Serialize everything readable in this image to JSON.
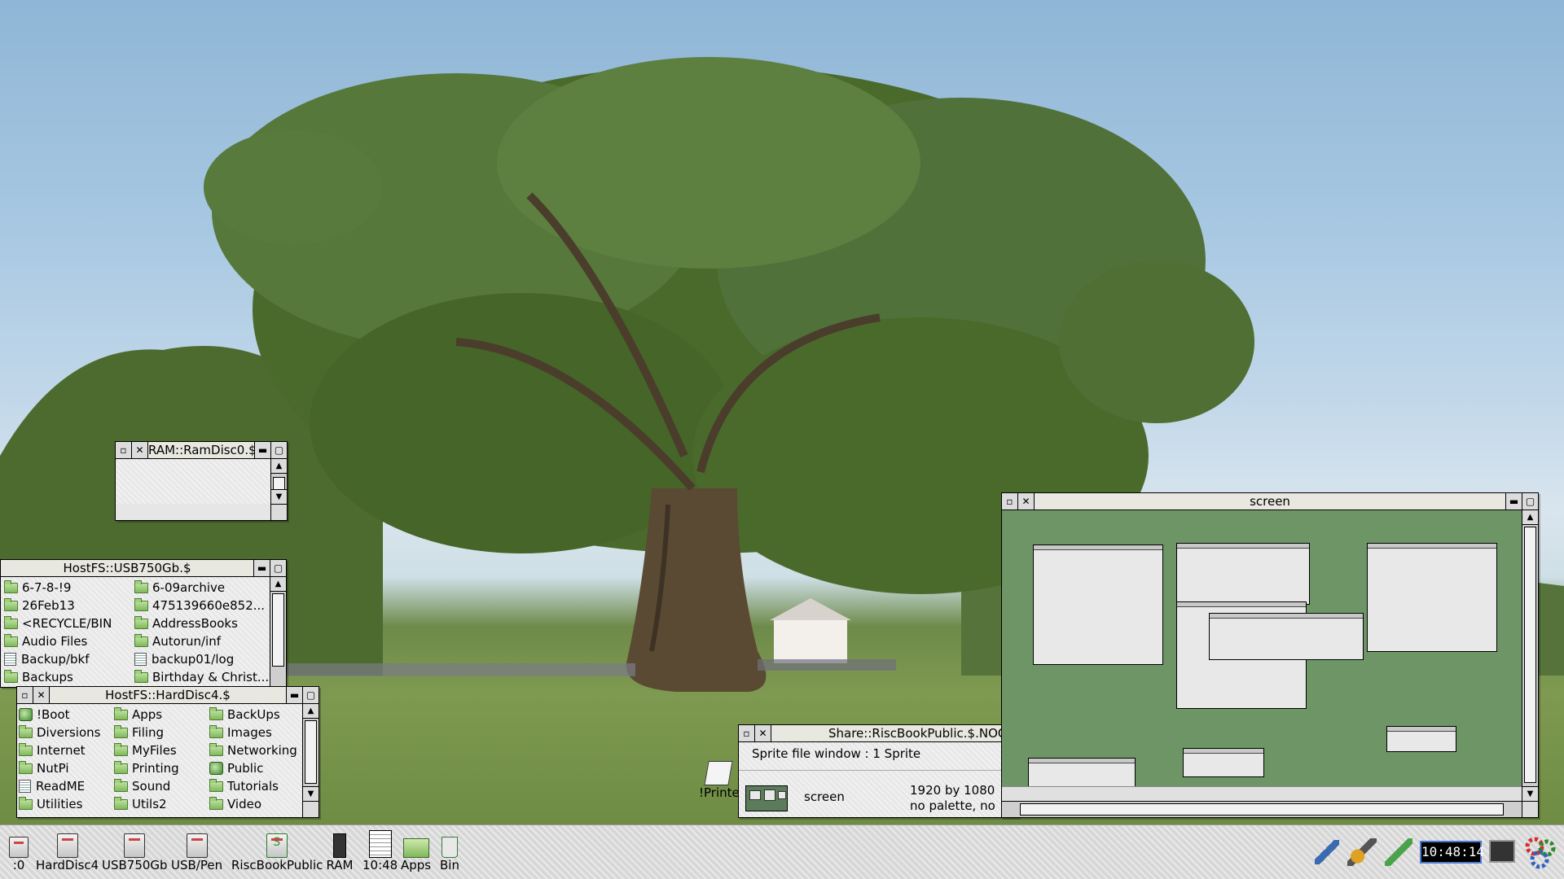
{
  "colors": {
    "desktop_sky": "#a8c8e2",
    "grass": "#7e9a50",
    "window_bg": "#e6e6e6",
    "screen_preview_bg": "#6e9566",
    "clock_border": "#4a7bd0"
  },
  "windows": {
    "ram": {
      "title": "RAM::RamDisc0.$"
    },
    "usb": {
      "title": "HostFS::USB750Gb.$",
      "items": [
        {
          "name": "6-7-8-!9",
          "icon": "folder-icon"
        },
        {
          "name": "6-09archive",
          "icon": "folder-icon"
        },
        {
          "name": "26Feb13",
          "icon": "folder-icon"
        },
        {
          "name": "475139660e852...",
          "icon": "folder-icon"
        },
        {
          "name": "<RECYCLE/BIN",
          "icon": "folder-icon"
        },
        {
          "name": "AddressBooks",
          "icon": "folder-icon"
        },
        {
          "name": "Audio Files",
          "icon": "folder-icon"
        },
        {
          "name": "Autorun/inf",
          "icon": "folder-icon"
        },
        {
          "name": "Backup/bkf",
          "icon": "file-icon"
        },
        {
          "name": "backup01/log",
          "icon": "file-icon"
        },
        {
          "name": "Backups",
          "icon": "folder-icon"
        },
        {
          "name": "Birthday & Christ...",
          "icon": "folder-icon"
        }
      ]
    },
    "harddisc": {
      "title": "HostFS::HardDisc4.$",
      "items": [
        {
          "name": "!Boot",
          "icon": "app-icon"
        },
        {
          "name": "Apps",
          "icon": "folder-icon"
        },
        {
          "name": "BackUps",
          "icon": "folder-icon"
        },
        {
          "name": "Diversions",
          "icon": "folder-icon"
        },
        {
          "name": "Filing",
          "icon": "folder-icon"
        },
        {
          "name": "Images",
          "icon": "folder-icon"
        },
        {
          "name": "Internet",
          "icon": "folder-icon"
        },
        {
          "name": "MyFiles",
          "icon": "folder-icon"
        },
        {
          "name": "Networking",
          "icon": "folder-icon"
        },
        {
          "name": "NutPi",
          "icon": "folder-icon"
        },
        {
          "name": "Printing",
          "icon": "folder-icon"
        },
        {
          "name": "Public",
          "icon": "app-icon"
        },
        {
          "name": "ReadME",
          "icon": "file-icon"
        },
        {
          "name": "Sound",
          "icon": "folder-icon"
        },
        {
          "name": "Tutorials",
          "icon": "folder-icon"
        },
        {
          "name": "Utilities",
          "icon": "folder-icon"
        },
        {
          "name": "Utils2",
          "icon": "folder-icon"
        },
        {
          "name": "Video",
          "icon": "folder-icon"
        }
      ]
    },
    "sprite": {
      "title": "Share::RiscBookPublic.$.NOOBs",
      "info": "Sprite file window : 1 Sprite",
      "sprite_name": "screen",
      "sprite_size": "1920 by 1080",
      "sprite_palette": "no palette, no mas"
    },
    "screen": {
      "title": "screen"
    }
  },
  "desktop": {
    "printer_label": "!Printer"
  },
  "iconbar": {
    "items": [
      {
        "label": ":0",
        "icon": "drive-icon"
      },
      {
        "label": "HardDisc4",
        "icon": "drive-icon"
      },
      {
        "label": "USB750Gb",
        "icon": "drive-icon"
      },
      {
        "label": "USB/Pen",
        "icon": "drive-icon"
      },
      {
        "label": "RiscBookPublic",
        "icon": "share-icon"
      },
      {
        "label": "RAM",
        "icon": "ram-icon"
      },
      {
        "label": "10:48",
        "icon": "alarm-icon"
      },
      {
        "label": "Apps",
        "icon": "apps-icon"
      },
      {
        "label": "Bin",
        "icon": "bin-icon"
      }
    ],
    "clock": "10:48:14"
  }
}
